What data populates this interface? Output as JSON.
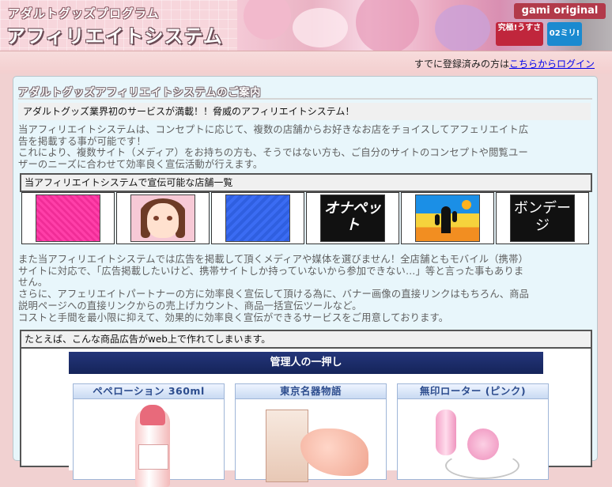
{
  "header": {
    "brand_sub": "アダルトグッズプログラム",
    "brand_main": "アフィリエイトシステム",
    "ad_badge": "gami original",
    "pkg1": "究極!うすさ",
    "pkg2": "02ミリ!"
  },
  "login_bar": {
    "prefix": "すでに登録済みの方は",
    "link": "こちらからログイン"
  },
  "panel": {
    "title": "アダルトグッズアフィリエイトシステムのご案内",
    "intro": "アダルトグッズ業界初のサービスが満載！！脅威のアフィリエイトシステム！",
    "para1": [
      "当アフィリエイトシステムは、コンセプトに応じて、複数の店舗からお好きなお店をチョイスしてアフェリエイト広",
      "告を掲載する事が可能です！",
      "これにより、複数サイト（メディア）をお持ちの方も、そうではない方も、ご自分のサイトのコンセプトや閲覧ユー",
      "ザーのニーズに合わせて効率良く宣伝活動が行えます。"
    ],
    "shops_heading": "当アフィリエイトシステムで宣伝可能な店舗一覧",
    "shops": [
      {
        "name": "shop-banner-pink",
        "label": ""
      },
      {
        "name": "shop-banner-anime-girl",
        "label": ""
      },
      {
        "name": "shop-banner-blue",
        "label": ""
      },
      {
        "name": "shop-banner-onapet",
        "label": "オナペット"
      },
      {
        "name": "shop-banner-cactus",
        "label": ""
      },
      {
        "name": "shop-banner-bondage",
        "label": "ボンデージ"
      }
    ],
    "para2": [
      "また当アフィリエイトシステムでは広告を掲載して頂くメディアや媒体を選びません！全店舗ともモバイル（携帯）",
      "サイトに対応で、「広告掲載したいけど、携帯サイトしか持っていないから参加できない…」等と言った事もありま",
      "せん。",
      "さらに、アフェリエイトパートナーの方に効率良く宣伝して頂ける為に、バナー画像の直接リンクはもちろん、商品",
      "説明ページへの直接リンクからの売上げカウント、商品一括宣伝ツールなど。",
      "コストと手間を最小限に抑えて、効果的に効率良く宣伝ができるサービスをご用意しております。"
    ],
    "example_heading": "たとえば、こんな商品広告がweb上で作れてしまいます。",
    "product_header": "管理人の一押し",
    "products": [
      {
        "name": "ペペローション 360ml"
      },
      {
        "name": "東京名器物語"
      },
      {
        "name": "無印ローター (ピンク)"
      }
    ]
  }
}
